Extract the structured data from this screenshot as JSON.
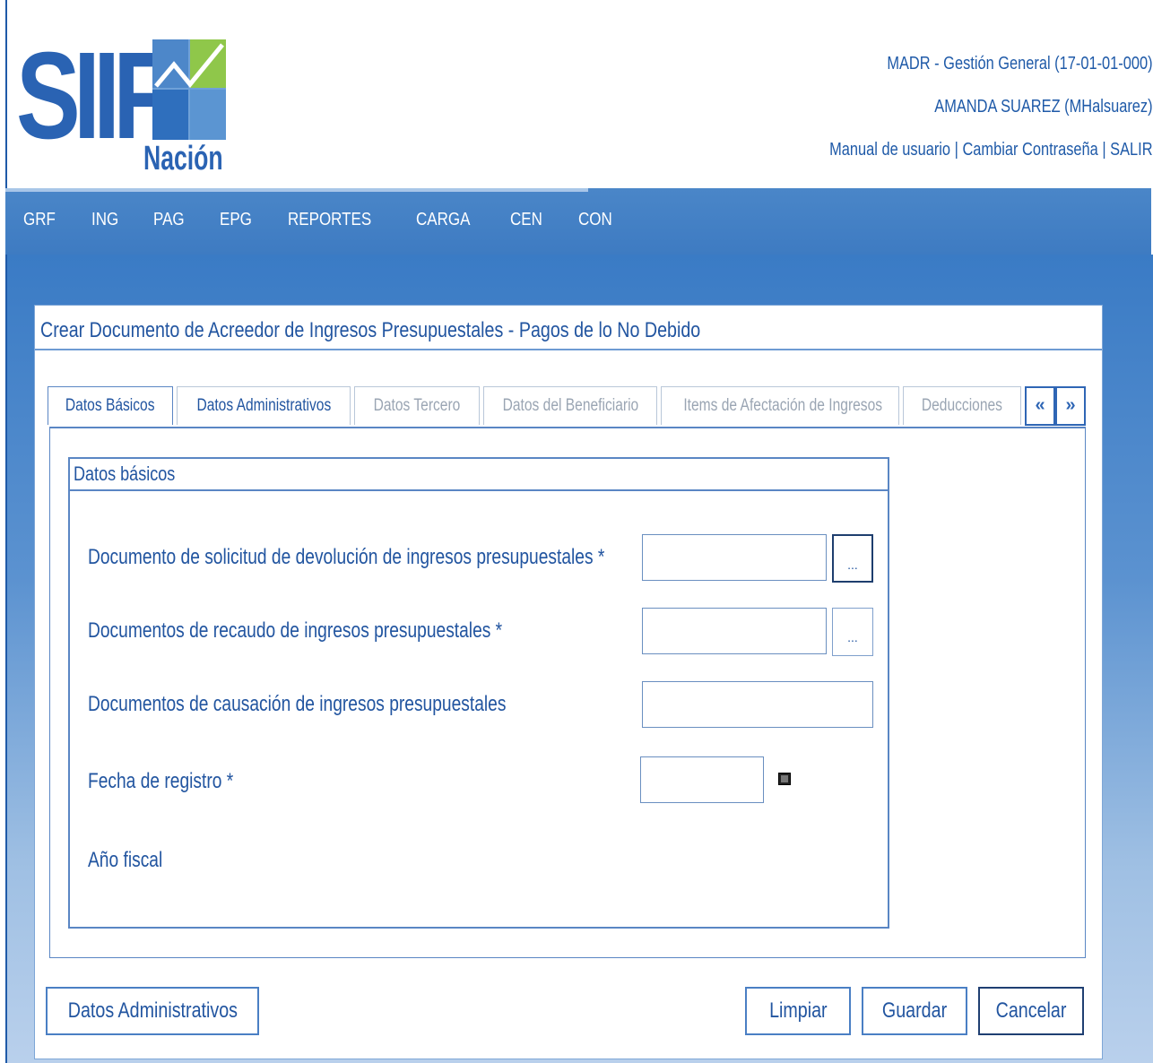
{
  "header": {
    "logo_text": "SIIF",
    "logo_subtext": "Nación",
    "entity": "MADR - Gestión General (17-01-01-000)",
    "user": "AMANDA SUAREZ (MHalsuarez)",
    "links": {
      "manual": "Manual de usuario",
      "sep1": "|",
      "change_password": "Cambiar Contraseña",
      "sep2": "|",
      "logout": "SALIR"
    }
  },
  "menu": [
    "GRF",
    "ING",
    "PAG",
    "EPG",
    "REPORTES",
    "CARGA",
    "CEN",
    "CON"
  ],
  "panel": {
    "title": "Crear Documento de Acreedor de Ingresos Presupuestales - Pagos de lo No Debido"
  },
  "tabs": [
    {
      "label": "Datos Básicos",
      "state": "active"
    },
    {
      "label": "Datos Administrativos",
      "state": "enabled"
    },
    {
      "label": "Datos Tercero",
      "state": "disabled"
    },
    {
      "label": "Datos del Beneficiario",
      "state": "disabled"
    },
    {
      "label": "Items de Afectación de Ingresos",
      "state": "disabled"
    },
    {
      "label": "Deducciones",
      "state": "disabled"
    }
  ],
  "tab_nav": {
    "prev": "«",
    "next": "»"
  },
  "form": {
    "legend": "Datos básicos",
    "fields": {
      "solicitud": {
        "label": "Documento de solicitud de devolución de ingresos presupuestales *",
        "value": "",
        "lookup": "..."
      },
      "recaudo": {
        "label": "Documentos de recaudo de ingresos presupuestales *",
        "value": "",
        "lookup": "..."
      },
      "causacion": {
        "label": "Documentos de causación de ingresos presupuestales",
        "value": ""
      },
      "fecha": {
        "label": "Fecha de registro *",
        "value": ""
      },
      "anio": {
        "label": "Año fiscal",
        "value": ""
      }
    }
  },
  "buttons": {
    "administrativos": "Datos Administrativos",
    "limpiar": "Limpiar",
    "guardar": "Guardar",
    "cancelar": "Cancelar"
  },
  "colors": {
    "primary": "#2255a0",
    "menubar": "#3e7bc2",
    "border": "#5a86c4"
  }
}
